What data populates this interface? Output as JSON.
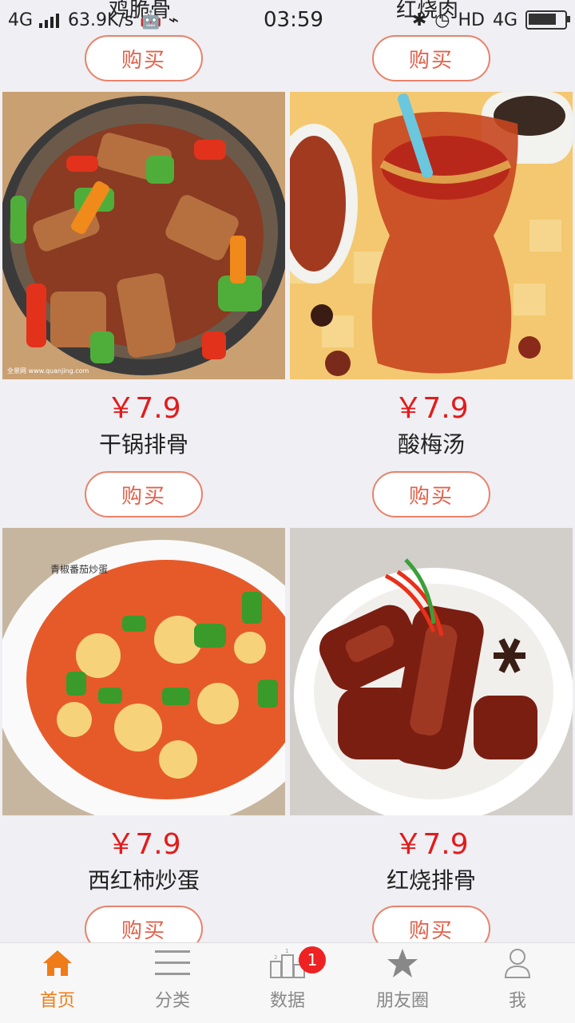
{
  "status_bar": {
    "network": "4G",
    "speed": "63.9K/s",
    "time": "03:59",
    "right_labels": [
      "HD",
      "4G"
    ]
  },
  "top_row": {
    "left_name": "鸡脆骨",
    "right_name": "红烧肉",
    "buy_label": "购买"
  },
  "products": [
    {
      "price": "￥7.9",
      "name": "干锅排骨",
      "buy_label": "购买"
    },
    {
      "price": "￥7.9",
      "name": "酸梅汤",
      "buy_label": "购买"
    },
    {
      "price": "￥7.9",
      "name": "西红柿炒蛋",
      "buy_label": "购买"
    },
    {
      "price": "￥7.9",
      "name": "红烧排骨",
      "buy_label": "购买"
    }
  ],
  "image_labels": {
    "tomato_egg": "青椒番茄炒蛋",
    "watermark": "全景网 www.quanjing.com"
  },
  "tabbar": {
    "items": [
      {
        "label": "首页",
        "icon": "home-icon",
        "active": true
      },
      {
        "label": "分类",
        "icon": "menu-icon"
      },
      {
        "label": "数据",
        "icon": "podium-icon",
        "badge": "1"
      },
      {
        "label": "朋友圈",
        "icon": "star-icon"
      },
      {
        "label": "我",
        "icon": "user-icon"
      }
    ]
  },
  "colors": {
    "accent": "#f07b19",
    "price": "#e31b1b",
    "button_border": "#e9826a",
    "background": "#efeff4"
  }
}
